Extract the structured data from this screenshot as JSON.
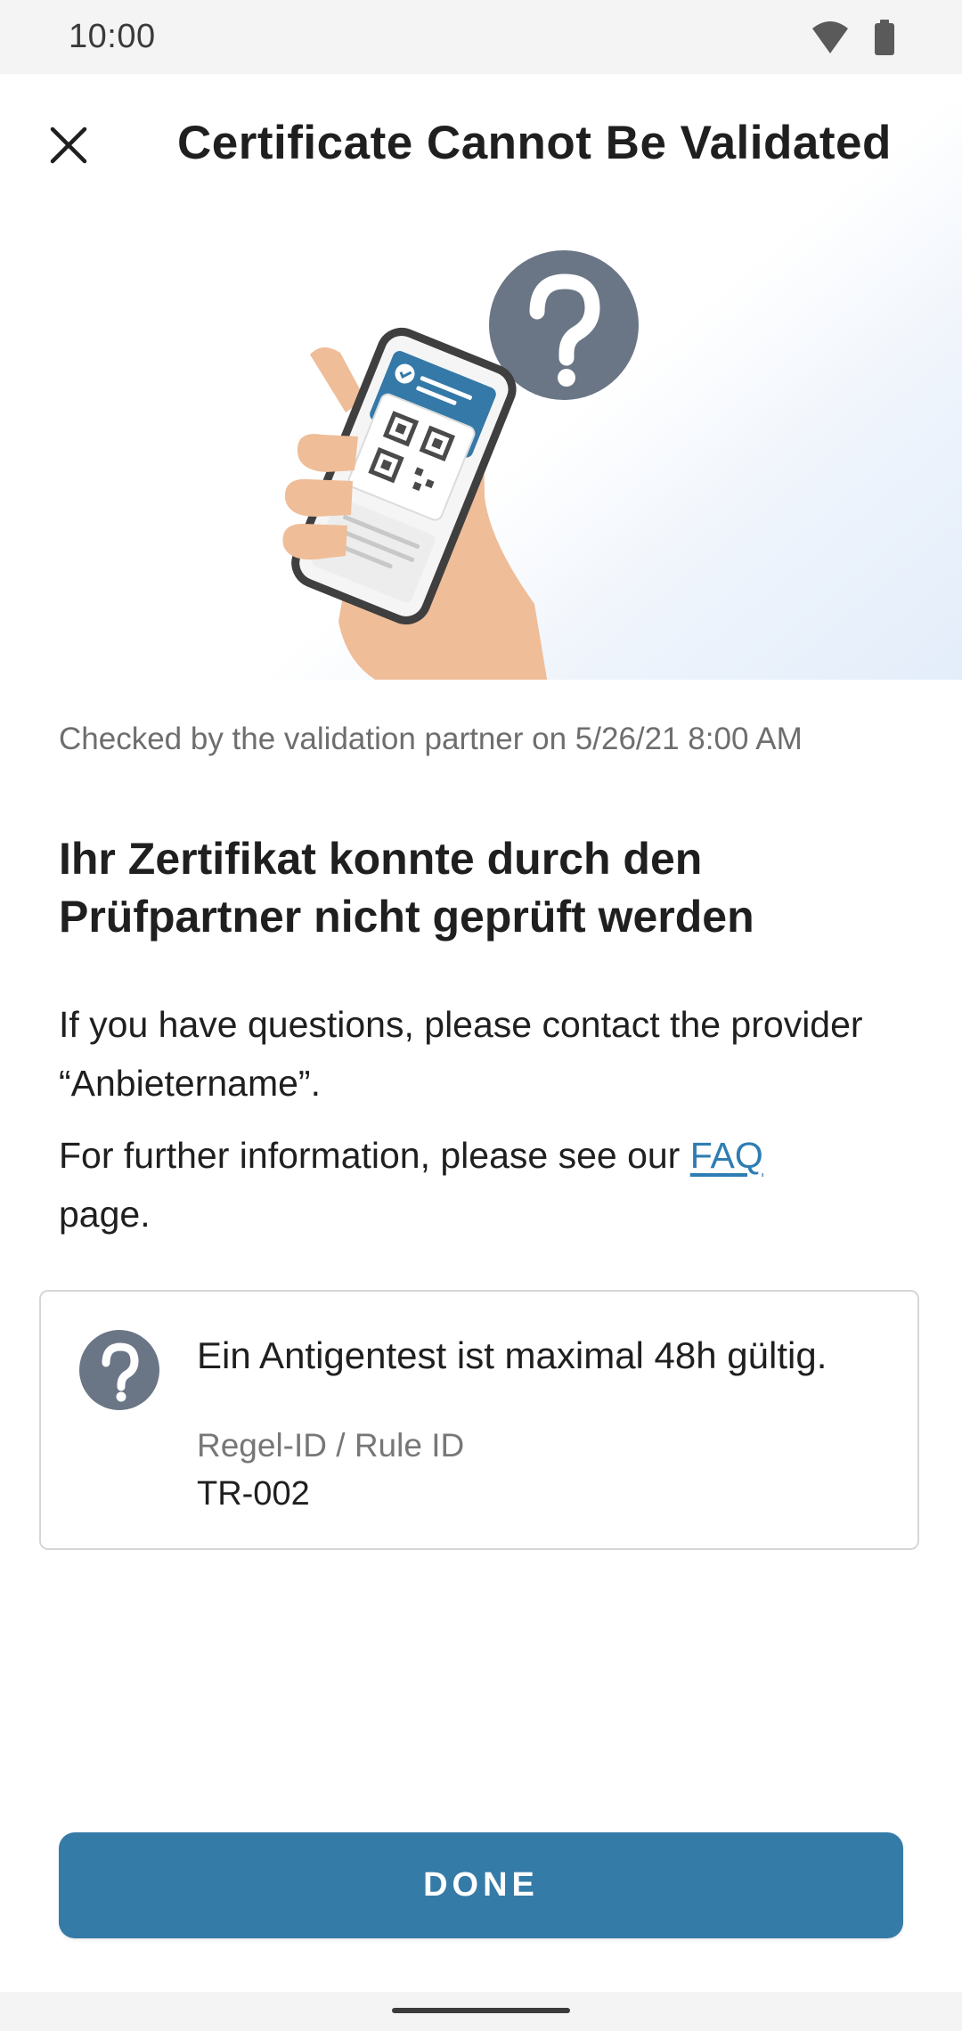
{
  "status_bar": {
    "time": "10:00",
    "icons": [
      "wifi-icon",
      "battery-icon"
    ]
  },
  "header": {
    "title": "Certificate Cannot Be Validated",
    "close_icon": "close-icon",
    "illustration": "hand-holding-phone-with-qr-certificate-and-question-mark"
  },
  "content": {
    "checked_text": "Checked by the validation partner on 5/26/21 8:00 AM",
    "heading": "Ihr Zertifikat konnte durch den Prüfpartner nicht geprüft werden",
    "contact_text": "If you have questions, please contact the provider “Anbietername”.",
    "faq_prefix": "For further information, please see our ",
    "faq_link": "FAQ",
    "faq_suffix": " page."
  },
  "rule_card": {
    "icon": "question-mark-icon",
    "text": "Ein Antigentest ist maximal 48h gültig.",
    "rule_id_label": "Regel-ID / Rule ID",
    "rule_id_value": "TR-002"
  },
  "done_button": {
    "label": "DONE"
  },
  "colors": {
    "accent": "#357ba8",
    "link": "#2e7db3",
    "icon_gray": "#6a7686",
    "skin": "#efbd98"
  }
}
